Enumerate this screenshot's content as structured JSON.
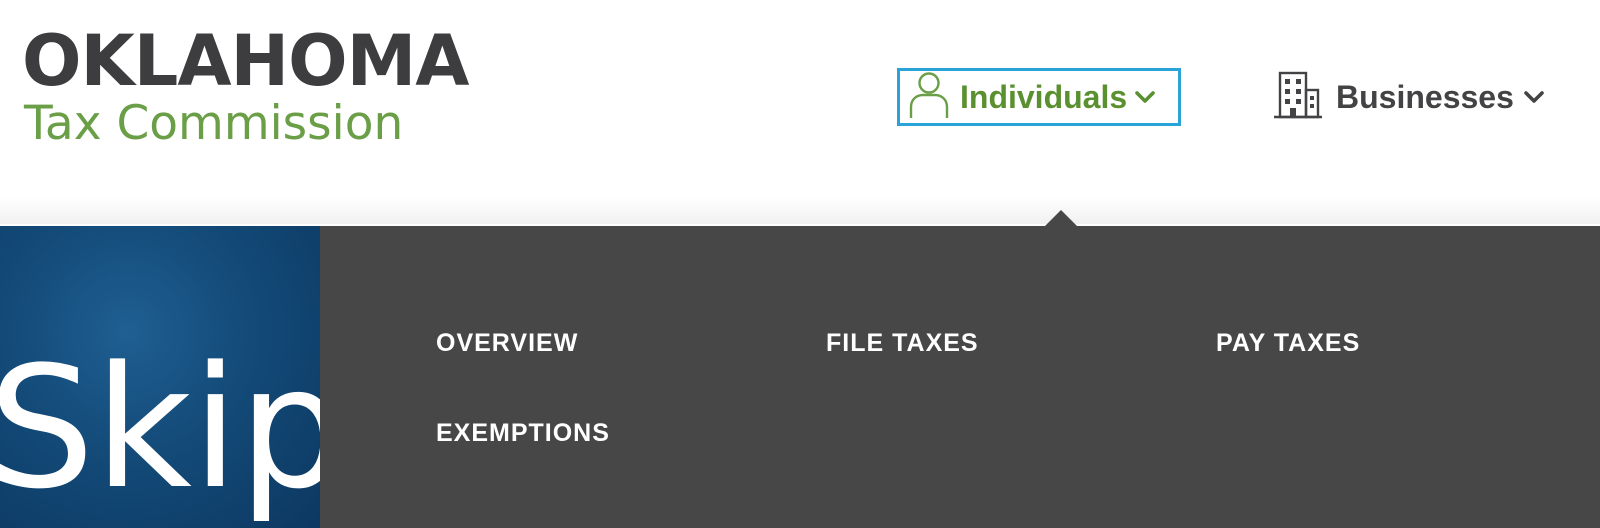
{
  "logo": {
    "top": "OKLAHOMA",
    "bottom": "Tax Commission"
  },
  "nav": {
    "individuals": {
      "label": "Individuals",
      "icon": "person-icon"
    },
    "businesses": {
      "label": "Businesses",
      "icon": "building-icon"
    }
  },
  "hero": {
    "text": "Skip"
  },
  "menu": {
    "items": [
      {
        "label": "OVERVIEW"
      },
      {
        "label": "FILE TAXES"
      },
      {
        "label": "PAY TAXES"
      },
      {
        "label": "EXEMPTIONS"
      }
    ]
  },
  "colors": {
    "brand_dark": "#3d3c3e",
    "brand_green": "#6a9e47",
    "nav_green": "#5b9030",
    "focus_blue": "#2aa3d8",
    "menu_bg": "#474748",
    "hero_blue": "#134a78"
  }
}
